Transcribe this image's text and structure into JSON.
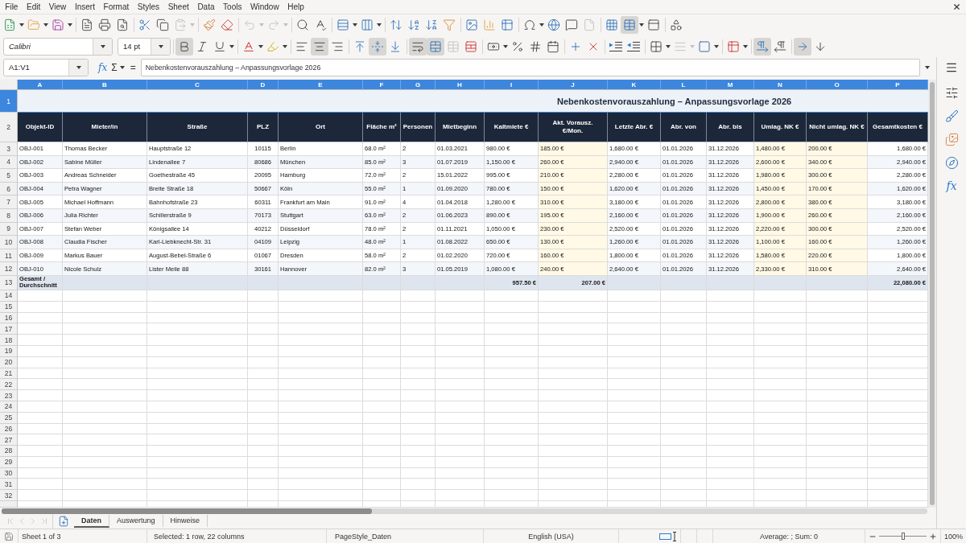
{
  "menu_bar": {
    "items": [
      "File",
      "Edit",
      "View",
      "Insert",
      "Format",
      "Styles",
      "Sheet",
      "Data",
      "Tools",
      "Window",
      "Help"
    ]
  },
  "standard_toolbar": {
    "paste_disabled": true,
    "undo_disabled": true,
    "redo_disabled": true,
    "header_footer_disabled": true,
    "freeze_rows_columns": true
  },
  "formatting_toolbar": {
    "font_name": "Calibri",
    "font_size": "14 pt",
    "bold": true,
    "italic": false,
    "underline": false,
    "align_left": false,
    "align_center": true,
    "align_right": false,
    "align_top": false,
    "align_middle": true,
    "align_bottom": false,
    "wrap_text": true,
    "merge_and_center": true,
    "merge_cells_disabled": true,
    "border_style_disabled": true,
    "left_to_right": true,
    "right_to_left": false,
    "text_horizontal": true,
    "text_vertical": false
  },
  "formula_bar": {
    "name_box": "A1:V1",
    "function_wizard": "fx",
    "sum": "Σ",
    "equals": "=",
    "formula": "Nebenkostenvorauszahlung – Anpassungsvorlage 2026"
  },
  "sheet": {
    "columns": [
      {
        "letter": "A",
        "selected": true,
        "input": false
      },
      {
        "letter": "B",
        "selected": true,
        "input": false
      },
      {
        "letter": "C",
        "selected": true,
        "input": false
      },
      {
        "letter": "D",
        "selected": true,
        "input": false
      },
      {
        "letter": "E",
        "selected": true,
        "input": false
      },
      {
        "letter": "F",
        "selected": true,
        "input": false
      },
      {
        "letter": "G",
        "selected": true,
        "input": false
      },
      {
        "letter": "H",
        "selected": true,
        "input": false
      },
      {
        "letter": "I",
        "selected": true,
        "input": false
      },
      {
        "letter": "J",
        "selected": true,
        "input": true
      },
      {
        "letter": "K",
        "selected": true,
        "input": false
      },
      {
        "letter": "L",
        "selected": true,
        "input": false
      },
      {
        "letter": "M",
        "selected": true,
        "input": false
      },
      {
        "letter": "N",
        "selected": true,
        "input": true
      },
      {
        "letter": "O",
        "selected": true,
        "input": true
      },
      {
        "letter": "P",
        "selected": true,
        "input": false
      }
    ],
    "rows": [
      {
        "number": "1",
        "selected": true,
        "kind": "title",
        "title": "Nebenkostenvorauszahlung – Anpassungsvorlage 2026"
      },
      {
        "number": "2",
        "selected": false,
        "kind": "header",
        "cells": [
          "Objekt-ID",
          "Mieter/in",
          "Straße",
          "PLZ",
          "Ort",
          "Fläche m²",
          "Personen",
          "Mietbeginn",
          "Kaltmiete €",
          "Akt. Vorausz.\n€/Mon.",
          "Letzte Abr. €",
          "Abr. von",
          "Abr. bis",
          "Umlag. NK €",
          "Nicht umlag. NK €",
          "Gesamtkosten €"
        ]
      },
      {
        "number": "3",
        "selected": false,
        "kind": "data",
        "cells": [
          "OBJ-001",
          "Thomas Becker",
          "Hauptstraße 12",
          "10115",
          "Berlin",
          "68.0 m²",
          "2",
          "01.03.2021",
          "980.00 €",
          "185.00 €",
          "1,680.00 €",
          "01.01.2026",
          "31.12.2026",
          "1,480.00 €",
          "200.00 €",
          "1,680.00 €"
        ]
      },
      {
        "number": "4",
        "selected": false,
        "kind": "data",
        "cells": [
          "OBJ-002",
          "Sabine Müller",
          "Lindenallee 7",
          "80686",
          "München",
          "85.0 m²",
          "3",
          "01.07.2019",
          "1,150.00 €",
          "260.00 €",
          "2,940.00 €",
          "01.01.2026",
          "31.12.2026",
          "2,600.00 €",
          "340.00 €",
          "2,940.00 €"
        ]
      },
      {
        "number": "5",
        "selected": false,
        "kind": "data",
        "cells": [
          "OBJ-003",
          "Andreas Schneider",
          "Goethestraße 45",
          "20095",
          "Hamburg",
          "72.0 m²",
          "2",
          "15.01.2022",
          "995.00 €",
          "210.00 €",
          "2,280.00 €",
          "01.01.2026",
          "31.12.2026",
          "1,980.00 €",
          "300.00 €",
          "2,280.00 €"
        ]
      },
      {
        "number": "6",
        "selected": false,
        "kind": "data",
        "cells": [
          "OBJ-004",
          "Petra Wagner",
          "Breite Straße 18",
          "50667",
          "Köln",
          "55.0 m²",
          "1",
          "01.09.2020",
          "780.00 €",
          "150.00 €",
          "1,620.00 €",
          "01.01.2026",
          "31.12.2026",
          "1,450.00 €",
          "170.00 €",
          "1,620.00 €"
        ]
      },
      {
        "number": "7",
        "selected": false,
        "kind": "data",
        "cells": [
          "OBJ-005",
          "Michael Hoffmann",
          "Bahnhofstraße 23",
          "60311",
          "Frankfurt am Main",
          "91.0 m²",
          "4",
          "01.04.2018",
          "1,280.00 €",
          "310.00 €",
          "3,180.00 €",
          "01.01.2026",
          "31.12.2026",
          "2,800.00 €",
          "380.00 €",
          "3,180.00 €"
        ]
      },
      {
        "number": "8",
        "selected": false,
        "kind": "data",
        "cells": [
          "OBJ-006",
          "Julia Richter",
          "Schillerstraße 9",
          "70173",
          "Stuttgart",
          "63.0 m²",
          "2",
          "01.06.2023",
          "890.00 €",
          "195.00 €",
          "2,160.00 €",
          "01.01.2026",
          "31.12.2026",
          "1,900.00 €",
          "260.00 €",
          "2,160.00 €"
        ]
      },
      {
        "number": "9",
        "selected": false,
        "kind": "data",
        "cells": [
          "OBJ-007",
          "Stefan Weber",
          "Königsallee 14",
          "40212",
          "Düsseldorf",
          "78.0 m²",
          "2",
          "01.11.2021",
          "1,050.00 €",
          "230.00 €",
          "2,520.00 €",
          "01.01.2026",
          "31.12.2026",
          "2,220.00 €",
          "300.00 €",
          "2,520.00 €"
        ]
      },
      {
        "number": "10",
        "selected": false,
        "kind": "data",
        "cells": [
          "OBJ-008",
          "Claudia Fischer",
          "Karl-Liebknecht-Str. 31",
          "04109",
          "Leipzig",
          "48.0 m²",
          "1",
          "01.08.2022",
          "650.00 €",
          "130.00 €",
          "1,260.00 €",
          "01.01.2026",
          "31.12.2026",
          "1,100.00 €",
          "160.00 €",
          "1,260.00 €"
        ]
      },
      {
        "number": "11",
        "selected": false,
        "kind": "data",
        "cells": [
          "OBJ-009",
          "Markus Bauer",
          "August-Bebel-Straße 6",
          "01067",
          "Dresden",
          "58.0 m²",
          "2",
          "01.02.2020",
          "720.00 €",
          "160.00 €",
          "1,800.00 €",
          "01.01.2026",
          "31.12.2026",
          "1,580.00 €",
          "220.00 €",
          "1,800.00 €"
        ]
      },
      {
        "number": "12",
        "selected": false,
        "kind": "data",
        "cells": [
          "OBJ-010",
          "Nicole Schulz",
          "Lister Meile 88",
          "30161",
          "Hannover",
          "82.0 m²",
          "3",
          "01.05.2019",
          "1,080.00 €",
          "240.00 €",
          "2,640.00 €",
          "01.01.2026",
          "31.12.2026",
          "2,330.00 €",
          "310.00 €",
          "2,640.00 €"
        ]
      },
      {
        "number": "13",
        "selected": false,
        "kind": "total",
        "cells": [
          "Gesamt / Durchschnitt",
          null,
          null,
          null,
          null,
          null,
          null,
          null,
          "957.50 €",
          "207.00 €",
          null,
          null,
          null,
          null,
          null,
          "22,080.00 €"
        ]
      },
      {
        "number": "14",
        "selected": false,
        "kind": "empty"
      },
      {
        "number": "15",
        "selected": false,
        "kind": "empty"
      },
      {
        "number": "16",
        "selected": false,
        "kind": "empty"
      },
      {
        "number": "17",
        "selected": false,
        "kind": "empty"
      },
      {
        "number": "18",
        "selected": false,
        "kind": "empty"
      },
      {
        "number": "19",
        "selected": false,
        "kind": "empty"
      },
      {
        "number": "20",
        "selected": false,
        "kind": "empty"
      },
      {
        "number": "21",
        "selected": false,
        "kind": "empty"
      },
      {
        "number": "22",
        "selected": false,
        "kind": "empty"
      },
      {
        "number": "23",
        "selected": false,
        "kind": "empty"
      },
      {
        "number": "24",
        "selected": false,
        "kind": "empty"
      },
      {
        "number": "25",
        "selected": false,
        "kind": "empty"
      },
      {
        "number": "26",
        "selected": false,
        "kind": "empty"
      },
      {
        "number": "27",
        "selected": false,
        "kind": "empty"
      },
      {
        "number": "28",
        "selected": false,
        "kind": "empty"
      },
      {
        "number": "29",
        "selected": false,
        "kind": "empty"
      },
      {
        "number": "30",
        "selected": false,
        "kind": "empty"
      },
      {
        "number": "31",
        "selected": false,
        "kind": "empty"
      },
      {
        "number": "32",
        "selected": false,
        "kind": "empty"
      }
    ]
  },
  "sheet_bar": {
    "navigation_disabled": true,
    "tabs": [
      {
        "label": "Daten",
        "selected": true
      },
      {
        "label": "Auswertung",
        "selected": false
      },
      {
        "label": "Hinweise",
        "selected": false
      }
    ]
  },
  "sidebar": {
    "functions": "fx"
  },
  "status_bar": {
    "sheet": "Sheet 1 of 3",
    "selection": "Selected: 1 row, 22 columns",
    "page_style": "PageStyle_Daten",
    "language": "English (USA)",
    "statistics": "Average: ; Sum: 0",
    "zoom": {
      "level": 0.5,
      "reading": "100%"
    }
  }
}
